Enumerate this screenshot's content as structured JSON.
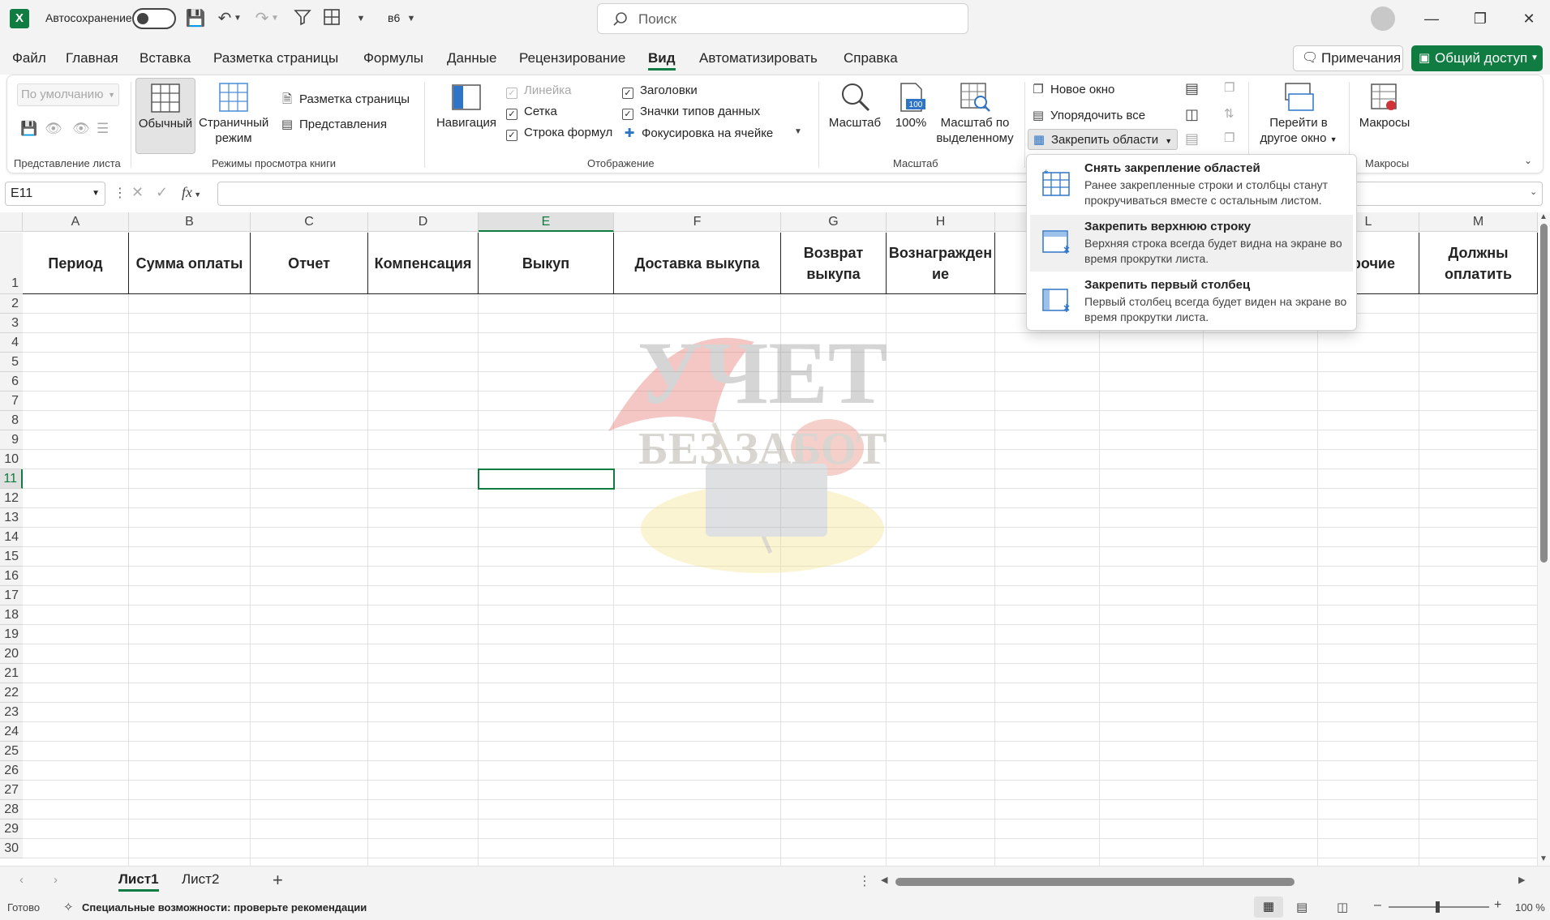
{
  "titlebar": {
    "autosave_label": "Автосохранение",
    "filename": "в6",
    "search_placeholder": "Поиск"
  },
  "menu": {
    "items": [
      "Файл",
      "Главная",
      "Вставка",
      "Разметка страницы",
      "Формулы",
      "Данные",
      "Рецензирование",
      "Вид",
      "Автоматизировать",
      "Справка"
    ],
    "active": "Вид",
    "comments_btn": "Примечания",
    "share_btn": "Общий доступ"
  },
  "ribbon": {
    "sheet_view": {
      "dropdown_value": "По умолчанию",
      "group_label": "Представление листа"
    },
    "workbook_views": {
      "normal": "Обычный",
      "page_break": "Страничный режим",
      "page_layout": "Разметка страницы",
      "custom_views": "Представления",
      "group_label": "Режимы просмотра книги"
    },
    "show": {
      "navigation": "Навигация",
      "ruler": "Линейка",
      "gridlines": "Сетка",
      "formula_bar": "Строка формул",
      "headings": "Заголовки",
      "data_type_icons": "Значки типов данных",
      "focus_cell": "Фокусировка на ячейке",
      "group_label": "Отображение"
    },
    "zoom": {
      "zoom": "Масштаб",
      "zoom100": "100%",
      "zoom_selection": "Масштаб по выделенному",
      "group_label": "Масштаб"
    },
    "window": {
      "new_window": "Новое окно",
      "arrange_all": "Упорядочить все",
      "freeze_panes": "Закрепить области",
      "switch_windows": "Перейти в другое окно"
    },
    "macros": {
      "label": "Макросы",
      "group_label": "Макросы"
    }
  },
  "formula_bar": {
    "name_box": "E11",
    "fx": "fx",
    "value": ""
  },
  "grid": {
    "columns": [
      "A",
      "B",
      "C",
      "D",
      "E",
      "F",
      "G",
      "H",
      "I",
      "J",
      "K",
      "L",
      "M"
    ],
    "selected_column": "E",
    "rows": [
      "1",
      "2",
      "3",
      "4",
      "5",
      "6",
      "7",
      "8",
      "9",
      "10",
      "11",
      "12",
      "13",
      "14",
      "15",
      "16",
      "17",
      "18",
      "19",
      "20",
      "21",
      "22",
      "23",
      "24",
      "25",
      "26",
      "27",
      "28",
      "29",
      "30"
    ],
    "selected_row": "11",
    "header_cells": [
      "Период",
      "Сумма оплаты",
      "Отчет",
      "Компенсация",
      "Выкуп",
      "Доставка выкупа",
      "Возврат выкупа",
      "Вознагражден ие",
      "",
      "",
      "",
      "Прочие",
      "Должны оплатить"
    ]
  },
  "watermark": {
    "line1": "УЧЕТ",
    "line2": "БЕЗ ЗАБОТ"
  },
  "freeze_menu": [
    {
      "title": "Снять закрепление областей",
      "desc": "Ранее закрепленные строки и столбцы станут прокручиваться вместе с остальным листом."
    },
    {
      "title": "Закрепить верхнюю строку",
      "desc": "Верхняя строка всегда будет видна на экране во время прокрутки листа."
    },
    {
      "title": "Закрепить первый столбец",
      "desc": "Первый столбец всегда будет виден на экране во время прокрутки листа."
    }
  ],
  "sheets": {
    "tabs": [
      "Лист1",
      "Лист2"
    ],
    "active": "Лист1"
  },
  "status": {
    "ready": "Готово",
    "accessibility": "Специальные возможности: проверьте рекомендации",
    "zoom": "100 %"
  },
  "colors": {
    "accent": "#107c41",
    "titlebar": "#f3f3f3",
    "header_border": "#222222"
  }
}
